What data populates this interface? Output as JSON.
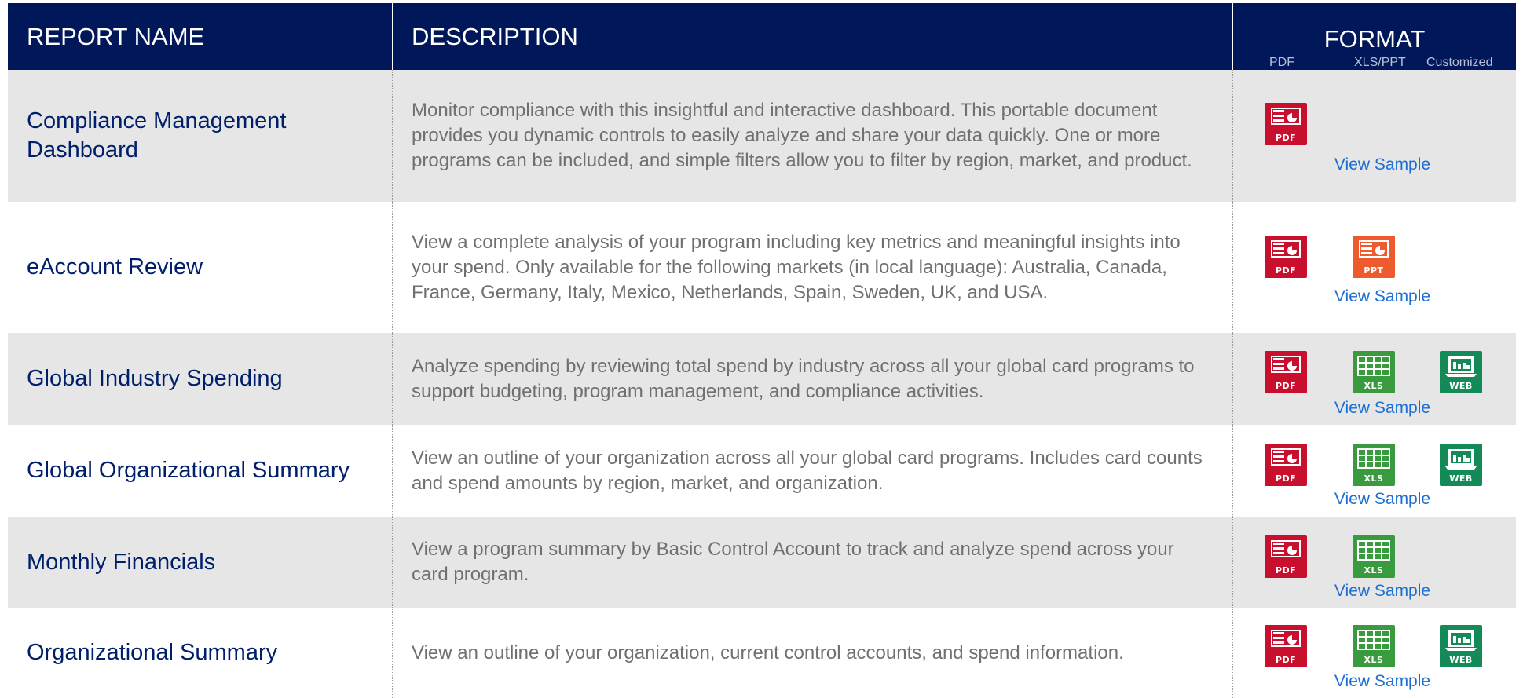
{
  "header": {
    "name_label": "REPORT NAME",
    "desc_label": "DESCRIPTION",
    "format_label": "FORMAT",
    "sub_pdf": "PDF",
    "sub_xls": "XLS/PPT",
    "sub_custom": "Customized"
  },
  "icon_labels": {
    "pdf": "PDF",
    "ppt": "PPT",
    "xls": "XLS",
    "web": "WEB"
  },
  "rows": [
    {
      "name": "Compliance Management Dashboard",
      "description": "Monitor compliance with this insightful and interactive dashboard. This portable document provides you dynamic controls to easily analyze and share your data quickly. One or more programs can be included, and simple filters allow you to filter by region, market, and product.",
      "formats": [
        "pdf"
      ],
      "link": "View Sample"
    },
    {
      "name": "eAccount Review",
      "description": "View a complete analysis of your program including key metrics and meaningful insights into your spend. Only available for the following markets (in local language): Australia, Canada, France, Germany, Italy, Mexico, Netherlands, Spain, Sweden, UK, and USA.",
      "formats": [
        "pdf",
        "ppt"
      ],
      "link": "View Sample"
    },
    {
      "name": "Global Industry Spending",
      "description": "Analyze spending by reviewing total spend by industry across all your global card programs to support budgeting, program management, and compliance activities.",
      "formats": [
        "pdf",
        "xls",
        "web"
      ],
      "link": "View Sample"
    },
    {
      "name": "Global Organizational Summary",
      "description": "View an outline of your organization across all your global card programs. Includes card counts and spend amounts by region, market, and organization.",
      "formats": [
        "pdf",
        "xls",
        "web"
      ],
      "link": "View Sample"
    },
    {
      "name": "Monthly Financials",
      "description": "View a program summary by Basic Control Account to track and analyze spend across your card program.",
      "formats": [
        "pdf",
        "xls"
      ],
      "link": "View Sample"
    },
    {
      "name": "Organizational Summary",
      "description": "View an outline of your organization, current control accounts, and spend information.",
      "formats": [
        "pdf",
        "xls",
        "web"
      ],
      "link": "View Sample"
    }
  ],
  "colors": {
    "header_bg": "#001759",
    "name_text": "#001f6b",
    "link": "#1b6fd3",
    "pdf": "#c8102e",
    "ppt": "#ee5a2e",
    "xls": "#3a9b3e",
    "web": "#138a58"
  },
  "icons": {
    "pdf": "pdf-document-icon",
    "ppt": "ppt-slide-icon",
    "xls": "spreadsheet-grid-icon",
    "web": "web-monitor-icon"
  }
}
